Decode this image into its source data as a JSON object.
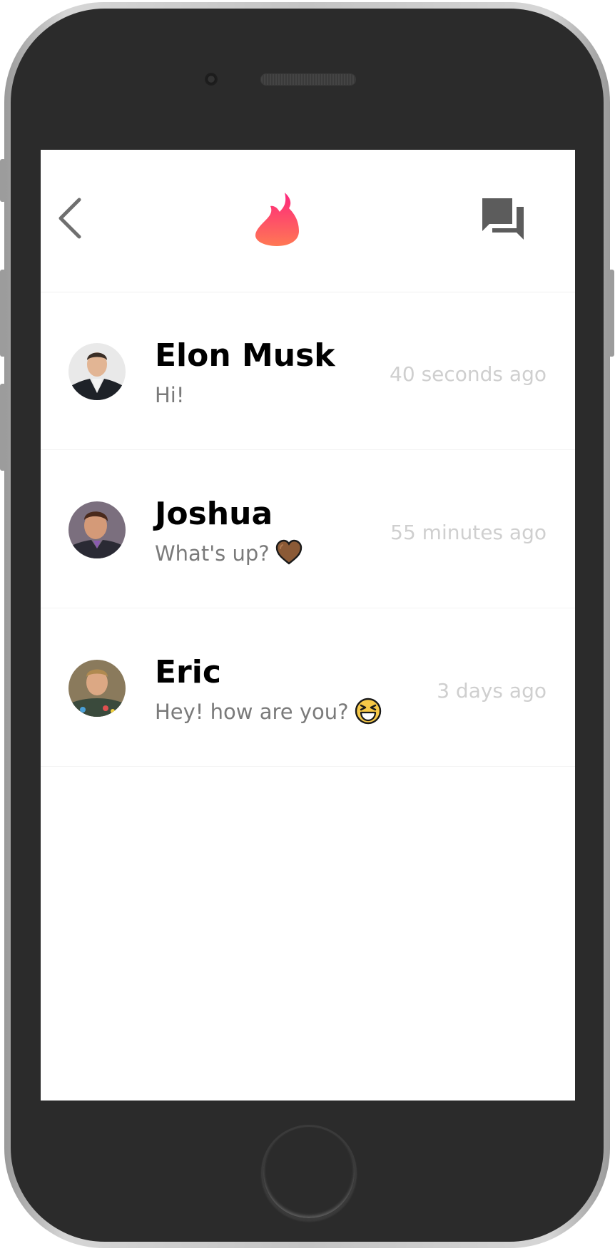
{
  "header": {
    "back_icon": "chevron-left-icon",
    "logo_icon": "flame-icon",
    "chat_icon": "chat-bubbles-icon",
    "brand_colors": {
      "flame_top": "#fd267d",
      "flame_bottom": "#ff7854"
    }
  },
  "conversations": [
    {
      "name": "Elon Musk",
      "message": "Hi!",
      "emoji": "",
      "time": "40 seconds ago"
    },
    {
      "name": "Joshua",
      "message": "What's up?",
      "emoji": "heart-brown",
      "time": "55 minutes ago"
    },
    {
      "name": "Eric",
      "message": "Hey! how are you?",
      "emoji": "laughing-face",
      "time": "3 days ago"
    }
  ]
}
